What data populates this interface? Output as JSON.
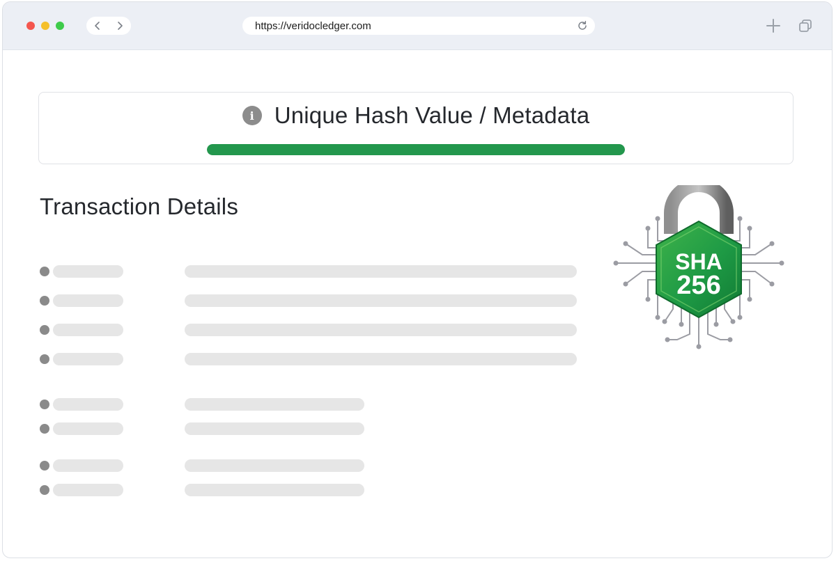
{
  "browser": {
    "url": "https://veridocledger.com",
    "back_icon": "chevron-left-icon",
    "forward_icon": "chevron-right-icon",
    "reload_icon": "reload-icon",
    "new_tab_icon": "plus-icon",
    "tabs_icon": "tabs-icon"
  },
  "hash_card": {
    "icon": "info-icon",
    "info_glyph": "i",
    "title": "Unique Hash Value / Metadata",
    "progress": 1.0
  },
  "transaction": {
    "title": "Transaction Details"
  },
  "badge": {
    "line1": "SHA",
    "line2": "256"
  },
  "colors": {
    "accent_green": "#23974d",
    "placeholder_gray": "#e6e6e6",
    "bullet_gray": "#8a8a8a",
    "chrome_bg": "#eceff5"
  }
}
